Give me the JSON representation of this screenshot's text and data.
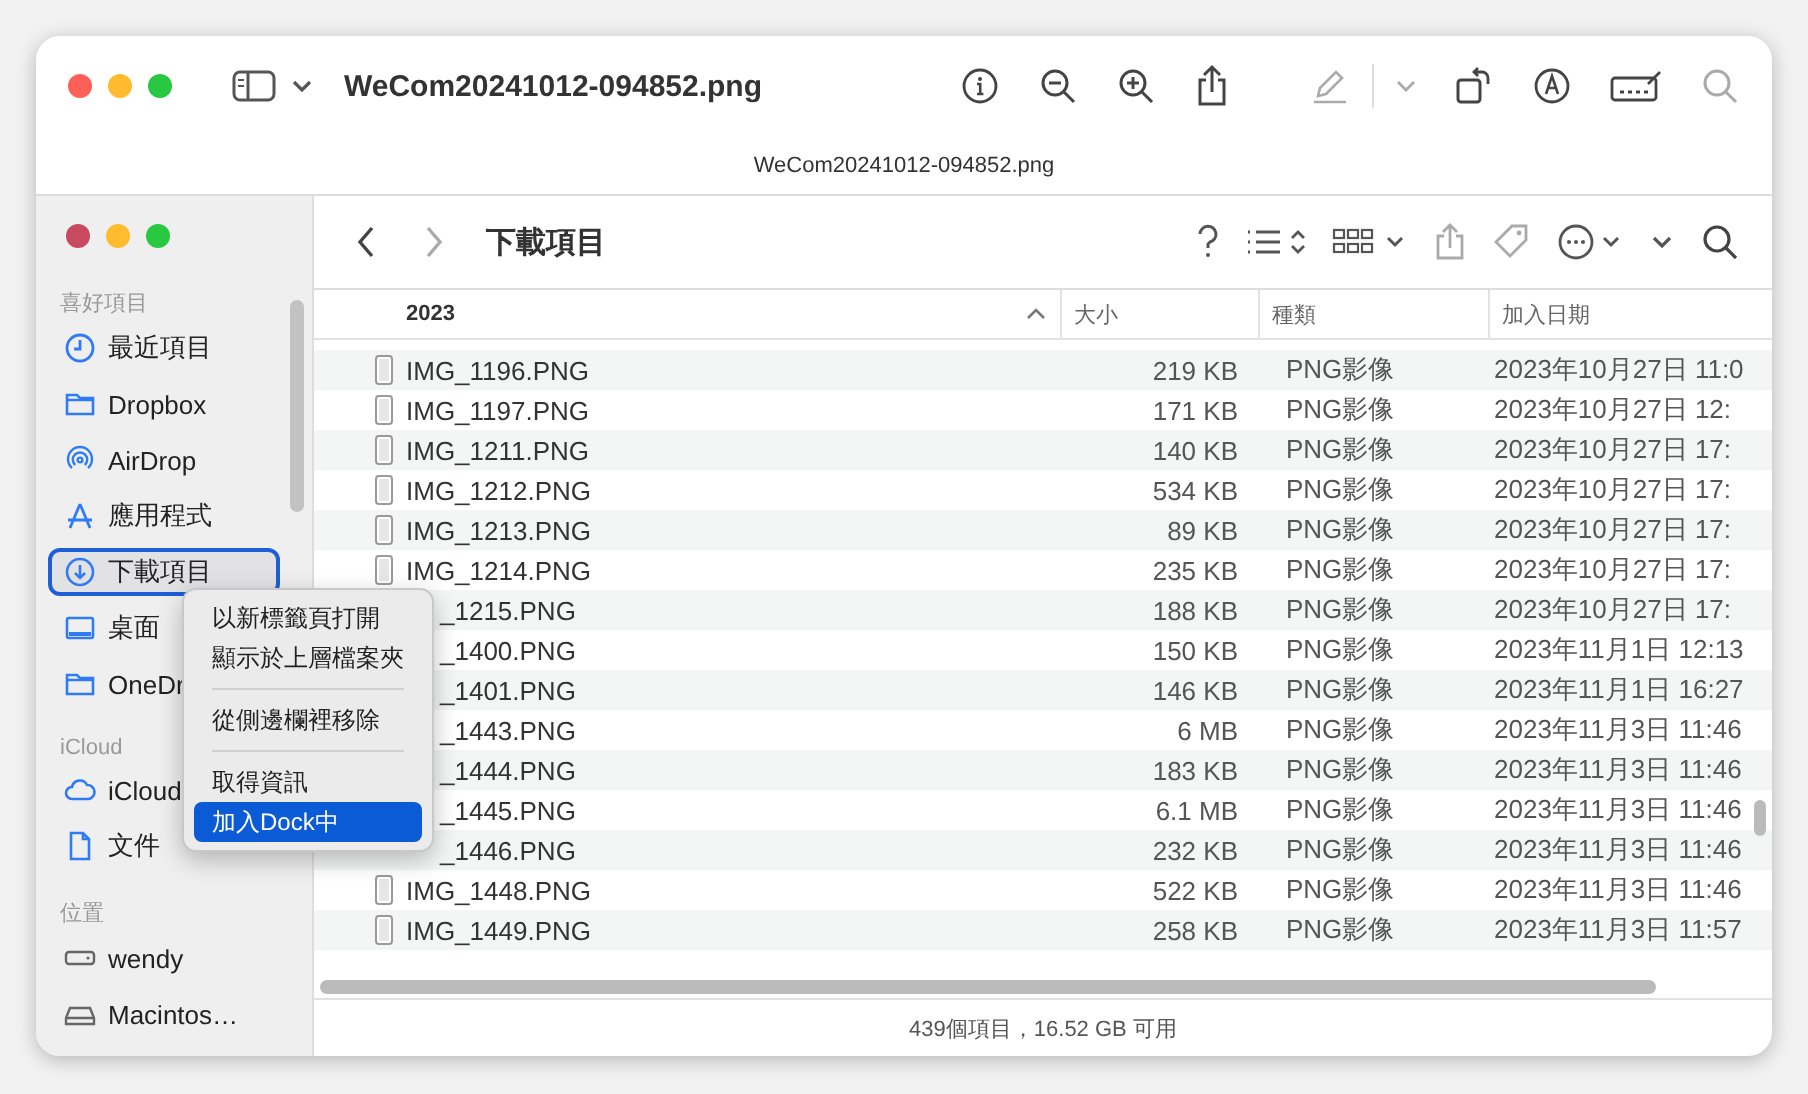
{
  "preview": {
    "title": "WeCom20241012-094852.png",
    "document_label": "WeCom20241012-094852.png"
  },
  "finder": {
    "title": "下載項目",
    "sidebar": [
      {
        "heading": "喜好項目",
        "items": [
          {
            "label": "最近項目",
            "selected": false
          },
          {
            "label": "Dropbox",
            "selected": false
          },
          {
            "label": "AirDrop",
            "selected": false
          },
          {
            "label": "應用程式",
            "selected": false
          },
          {
            "label": "下載項目",
            "selected": true
          },
          {
            "label": "桌面",
            "selected": false
          },
          {
            "label": "OneDr",
            "selected": false
          }
        ]
      },
      {
        "heading": "iCloud",
        "items": [
          {
            "label": "iCloud",
            "selected": false
          },
          {
            "label": "文件",
            "selected": false
          }
        ]
      },
      {
        "heading": "位置",
        "items": [
          {
            "label": "wendy",
            "selected": false
          },
          {
            "label": "Macintos…",
            "selected": false
          }
        ]
      }
    ],
    "columns": [
      "2023",
      "大小",
      "種類",
      "加入日期"
    ],
    "rows": [
      {
        "name": "IMG_1196.PNG",
        "size": "219 KB",
        "file_type": "PNG影像",
        "date_added": "2023年10月27日 11:0"
      },
      {
        "name": "IMG_1197.PNG",
        "size": "171 KB",
        "file_type": "PNG影像",
        "date_added": "2023年10月27日 12:"
      },
      {
        "name": "IMG_1211.PNG",
        "size": "140 KB",
        "file_type": "PNG影像",
        "date_added": "2023年10月27日 17:"
      },
      {
        "name": "IMG_1212.PNG",
        "size": "534 KB",
        "file_type": "PNG影像",
        "date_added": "2023年10月27日 17:"
      },
      {
        "name": "IMG_1213.PNG",
        "size": "89 KB",
        "file_type": "PNG影像",
        "date_added": "2023年10月27日 17:"
      },
      {
        "name": "IMG_1214.PNG",
        "size": "235 KB",
        "file_type": "PNG影像",
        "date_added": "2023年10月27日 17:"
      },
      {
        "name": "_1215.PNG",
        "size": "188 KB",
        "file_type": "PNG影像",
        "date_added": "2023年10月27日 17:"
      },
      {
        "name": "_1400.PNG",
        "size": "150 KB",
        "file_type": "PNG影像",
        "date_added": "2023年11月1日 12:13"
      },
      {
        "name": "_1401.PNG",
        "size": "146 KB",
        "file_type": "PNG影像",
        "date_added": "2023年11月1日 16:27"
      },
      {
        "name": "_1443.PNG",
        "size": "6 MB",
        "file_type": "PNG影像",
        "date_added": "2023年11月3日 11:46"
      },
      {
        "name": "_1444.PNG",
        "size": "183 KB",
        "file_type": "PNG影像",
        "date_added": "2023年11月3日 11:46"
      },
      {
        "name": "_1445.PNG",
        "size": "6.1 MB",
        "file_type": "PNG影像",
        "date_added": "2023年11月3日 11:46"
      },
      {
        "name": "_1446.PNG",
        "size": "232 KB",
        "file_type": "PNG影像",
        "date_added": "2023年11月3日 11:46"
      },
      {
        "name": "IMG_1448.PNG",
        "size": "522 KB",
        "file_type": "PNG影像",
        "date_added": "2023年11月3日 11:46"
      },
      {
        "name": "IMG_1449.PNG",
        "size": "258 KB",
        "file_type": "PNG影像",
        "date_added": "2023年11月3日 11:57"
      }
    ],
    "status": "439個項目，16.52 GB 可用"
  },
  "context_menu": [
    {
      "kind": "item",
      "label": "以新標籤頁打開",
      "selected": false
    },
    {
      "kind": "item",
      "label": "顯示於上層檔案夾",
      "selected": false
    },
    {
      "kind": "separator"
    },
    {
      "kind": "item",
      "label": "從側邊欄裡移除",
      "selected": false
    },
    {
      "kind": "separator"
    },
    {
      "kind": "item",
      "label": "取得資訊",
      "selected": false
    },
    {
      "kind": "item",
      "label": "加入Dock中",
      "selected": true
    }
  ]
}
